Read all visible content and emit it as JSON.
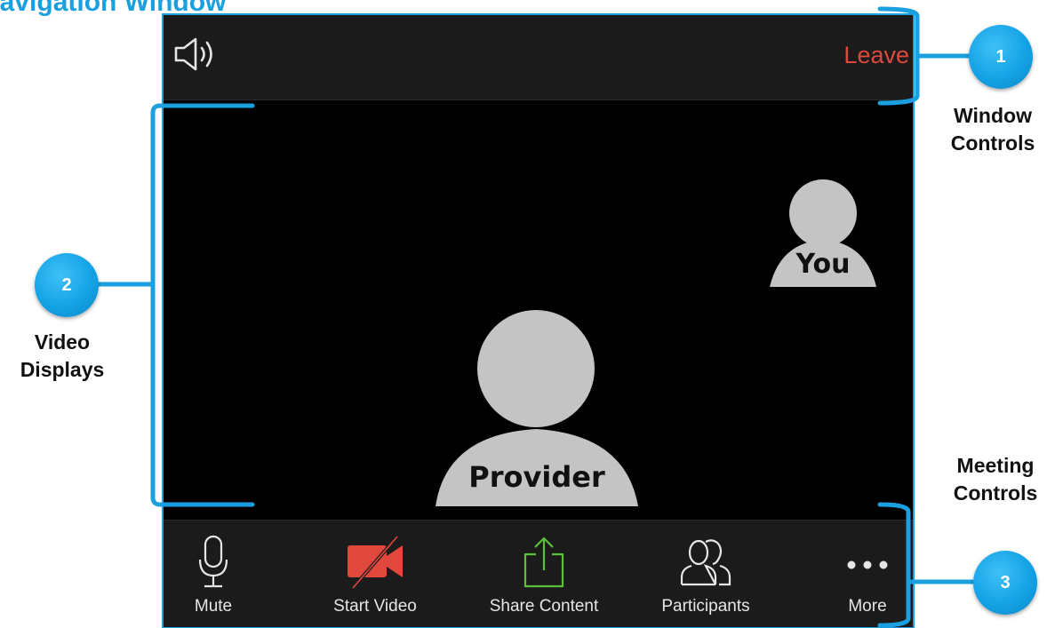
{
  "heading": "Navigation Window",
  "window": {
    "leave_label": "Leave",
    "speaker_icon": "speaker-icon"
  },
  "video": {
    "self_label": "You",
    "remote_label": "Provider"
  },
  "controls": [
    {
      "label": "Mute",
      "icon": "microphone-icon"
    },
    {
      "label": "Start Video",
      "icon": "video-off-icon"
    },
    {
      "label": "Share Content",
      "icon": "share-icon"
    },
    {
      "label": "Participants",
      "icon": "participants-icon"
    },
    {
      "label": "More",
      "icon": "more-icon"
    }
  ],
  "annotations": [
    {
      "number": "1",
      "line1": "Window",
      "line2": "Controls"
    },
    {
      "number": "2",
      "line1": "Video",
      "line2": "Displays"
    },
    {
      "number": "3",
      "line1": "Meeting",
      "line2": "Controls"
    }
  ],
  "colors": {
    "accent": "#1aa0e0",
    "leave": "#e0483e",
    "video_off": "#e0483e",
    "share": "#5ac13a",
    "avatar": "#c4c4c4"
  }
}
